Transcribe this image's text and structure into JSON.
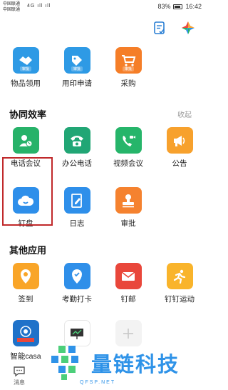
{
  "status": {
    "carrier1": "中国联通",
    "carrier2": "中国联通",
    "signal": "4G ıll ıll",
    "battery": "83%",
    "time": "16:42"
  },
  "top_row": [
    {
      "label": "物品领用",
      "tag": "审批",
      "color": "#2e9ae5"
    },
    {
      "label": "用印申请",
      "tag": "审批",
      "color": "#2e9ae5"
    },
    {
      "label": "采购",
      "tag": "审批",
      "color": "#f57e28"
    }
  ],
  "collab": {
    "title": "协同效率",
    "collapse": "收起",
    "items": [
      {
        "label": "电话会议",
        "color": "#27b269",
        "icon": "phone-meeting-icon"
      },
      {
        "label": "办公电话",
        "color": "#21a675",
        "icon": "office-phone-icon"
      },
      {
        "label": "视频会议",
        "color": "#26b56a",
        "icon": "video-call-icon"
      },
      {
        "label": "公告",
        "color": "#f7a12d",
        "icon": "megaphone-icon"
      },
      {
        "label": "钉盘",
        "color": "#2e8fea",
        "icon": "cloud-drive-icon"
      },
      {
        "label": "日志",
        "color": "#2e8fea",
        "icon": "journal-icon"
      },
      {
        "label": "审批",
        "color": "#f5822f",
        "icon": "approval-stamp-icon"
      }
    ]
  },
  "other": {
    "title": "其他应用",
    "items": [
      {
        "label": "签到",
        "color": "#f9a528",
        "icon": "location-pin-icon"
      },
      {
        "label": "考勤打卡",
        "color": "#2f8fe9",
        "icon": "check-pin-icon"
      },
      {
        "label": "钉邮",
        "color": "#e9473b",
        "icon": "mail-icon"
      },
      {
        "label": "钉钉运动",
        "color": "#f9b42b",
        "icon": "runner-icon"
      },
      {
        "label": "智能casa",
        "color": "#1f72c9",
        "icon": "smart-service-icon"
      },
      {
        "label": "",
        "color": "#ffffff",
        "icon": "presentation-icon"
      },
      {
        "label": "",
        "color": "#f3f3f3",
        "icon": "add-icon"
      }
    ]
  },
  "nav": {
    "messages": "消息"
  },
  "watermark": {
    "text": "量链科技",
    "sub": "QFSP.NET"
  }
}
